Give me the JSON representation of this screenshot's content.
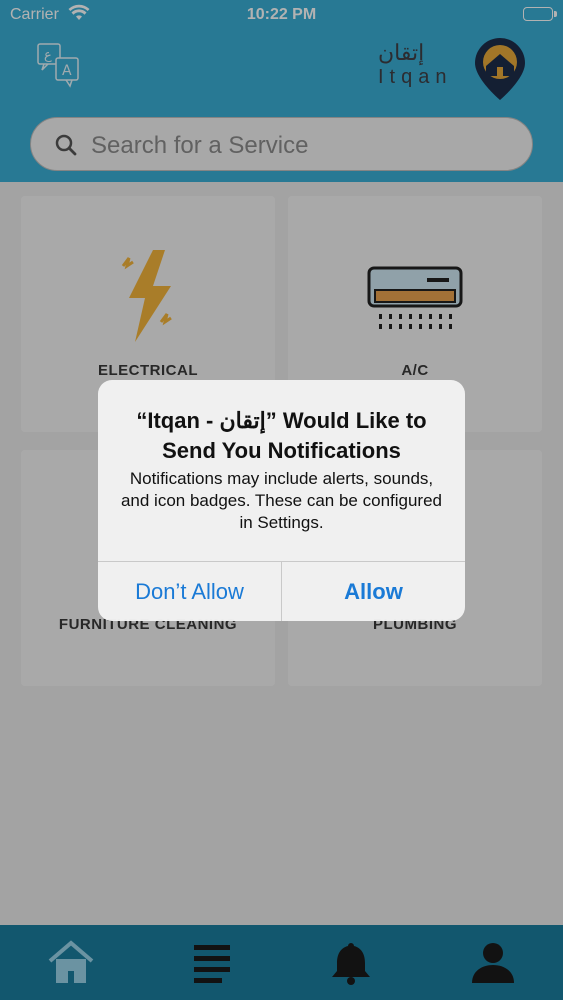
{
  "status_bar": {
    "carrier": "Carrier",
    "time": "10:22 PM"
  },
  "header": {
    "logo_arabic": "إتقان",
    "logo_latin": "Itqan",
    "language_icon": "translate-icon"
  },
  "search": {
    "placeholder": "Search for a Service"
  },
  "services": [
    {
      "label": "ELECTRICAL",
      "icon": "lightning-icon"
    },
    {
      "label": "A/C",
      "icon": "air-conditioner-icon"
    },
    {
      "label": "FURNITURE CLEANING",
      "icon": "sofa-icon"
    },
    {
      "label": "PLUMBING",
      "icon": "pipe-icon"
    }
  ],
  "alert": {
    "title": "“Itqan - إتقان” Would Like to Send You Notifications",
    "message": "Notifications may include alerts, sounds, and icon badges. These can be configured in Settings.",
    "dont_allow": "Don’t Allow",
    "allow": "Allow"
  },
  "tabbar": {
    "tabs": [
      "home-icon",
      "menu-icon",
      "bell-icon",
      "profile-icon"
    ]
  },
  "colors": {
    "header": "#3aaed4",
    "tabbar": "#1a7d9e",
    "accent": "#1a7ad6"
  }
}
